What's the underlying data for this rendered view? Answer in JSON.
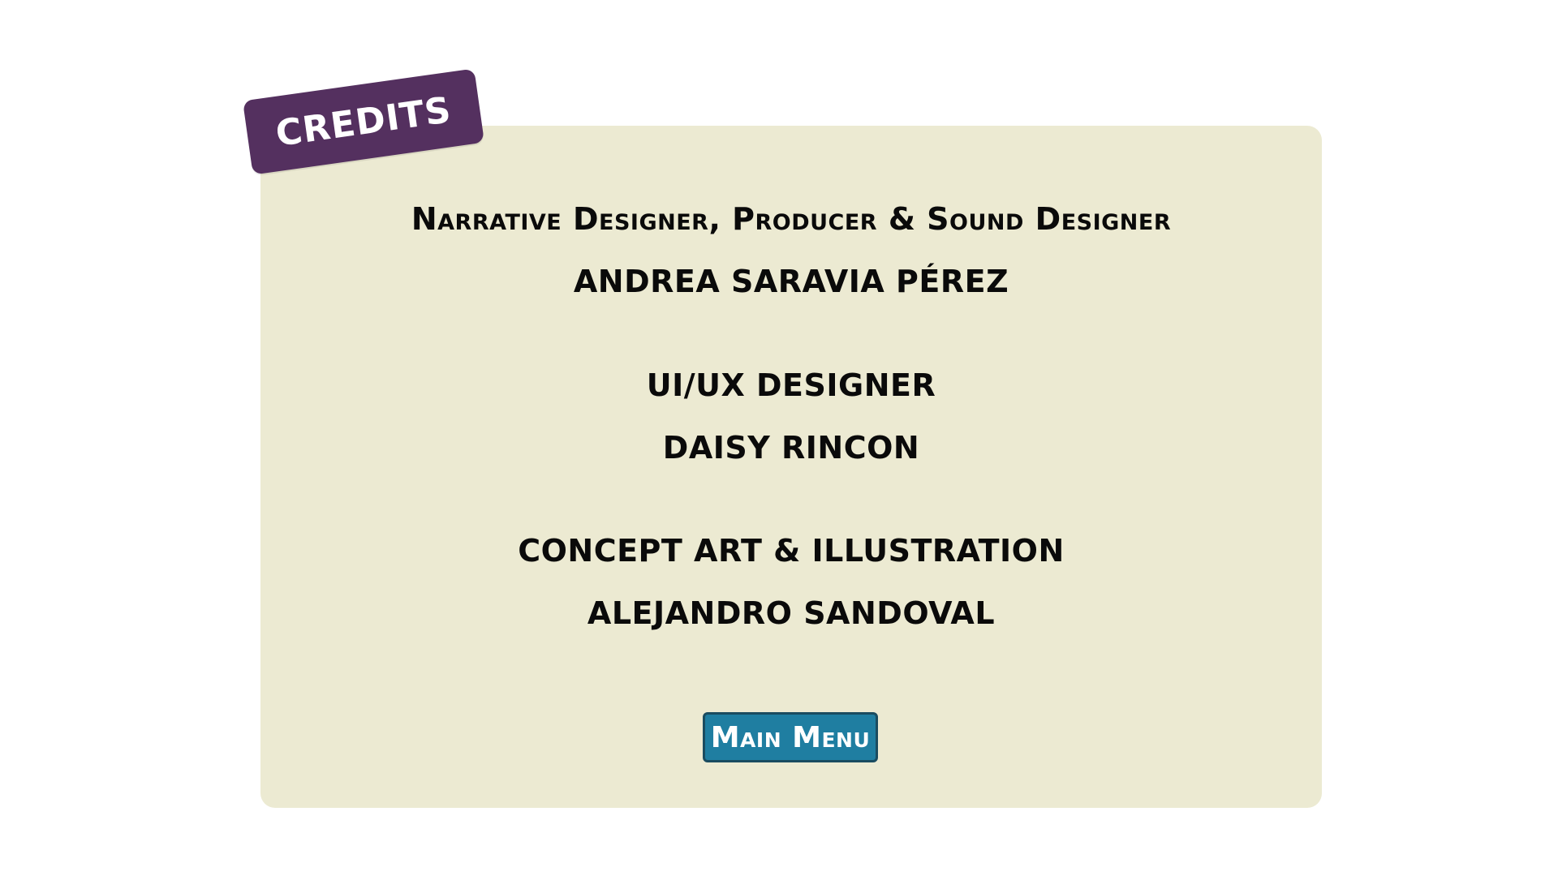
{
  "screen": {
    "tag_label": "CREDITS"
  },
  "credits": [
    {
      "role": "Narrative Designer, Producer & Sound Designer",
      "name": "ANDREA SARAVIA PÉREZ"
    },
    {
      "role": "UI/UX DESIGNER",
      "name": "DAISY RINCON"
    },
    {
      "role": "CONCEPT ART & ILLUSTRATION",
      "name": "ALEJANDRO SANDOVAL"
    }
  ],
  "buttons": {
    "main_menu_label": "Main Menu"
  },
  "colors": {
    "panel_background": "#ecead2",
    "tag_background": "#54305f",
    "button_background": "#1f7ea1",
    "button_border": "#1a4c60",
    "text": "#0a0a0a"
  }
}
